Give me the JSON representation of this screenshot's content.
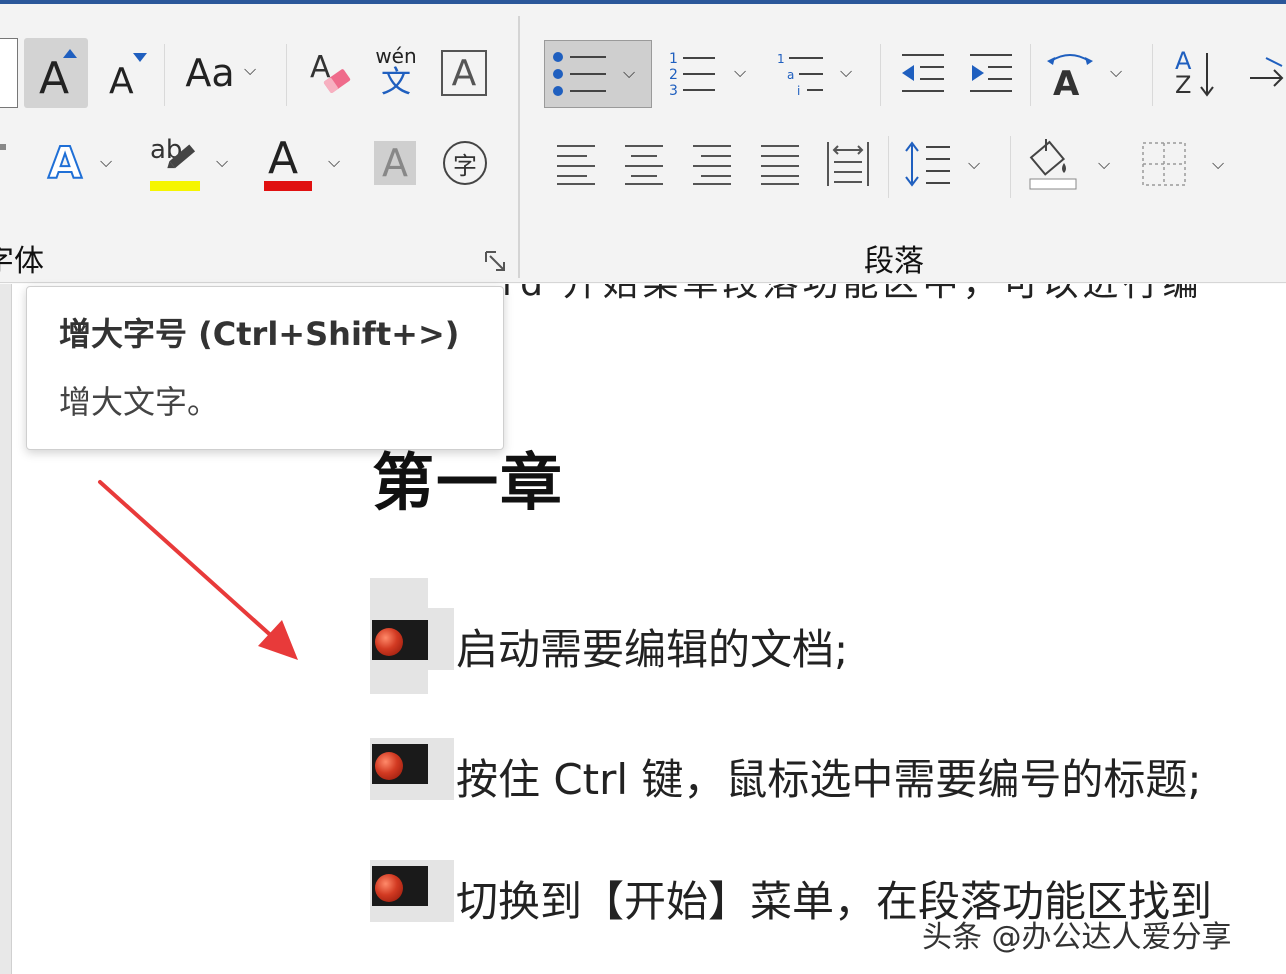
{
  "ribbon": {
    "font_group": {
      "label": "字体",
      "grow_font_label": "A",
      "shrink_font_label": "A",
      "change_case_label": "Aa",
      "phonetic_pinyin": "wén",
      "phonetic_char": "文",
      "char_border_label": "A",
      "text_effect_label": "A",
      "highlight_label": "ab",
      "font_color_label": "A",
      "char_shading_label": "A",
      "enclose_char_label": "字",
      "highlight_color": "#f5f500",
      "font_color": "#e01010"
    },
    "paragraph_group": {
      "label": "段落",
      "sort_top": "A",
      "sort_bottom": "Z"
    }
  },
  "tooltip": {
    "title": "增大字号 (Ctrl+Shift+>)",
    "description": "增大文字。"
  },
  "document": {
    "cutoff_line": "rd 开始菜单段落功能区中，可以进行编",
    "heading": "第一章",
    "list_items": [
      "启动需要编辑的文档;",
      "按住 Ctrl 键，鼠标选中需要编号的标题;",
      "切换到【开始】菜单，在段落功能区找到"
    ]
  },
  "watermark": "头条 @办公达人爱分享",
  "colors": {
    "accent": "#2b579a",
    "arrow": "#e83a3a",
    "bullet_blue": "#1f5fbf"
  }
}
